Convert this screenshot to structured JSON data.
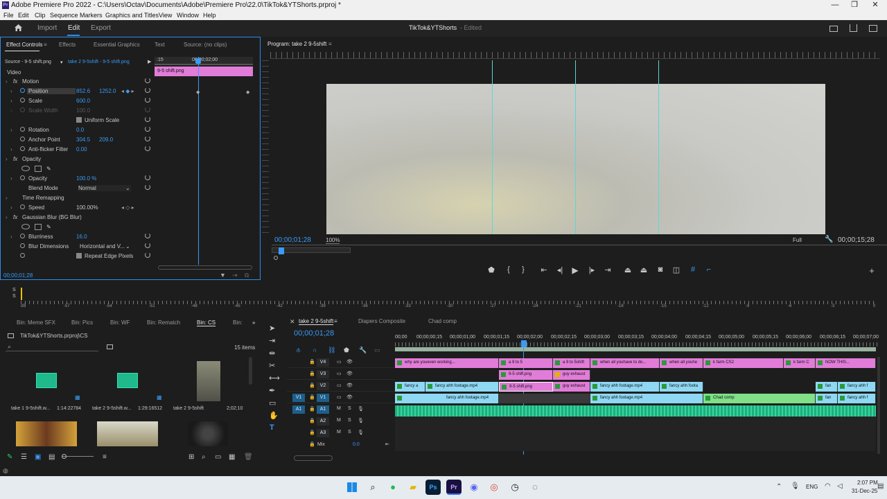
{
  "window": {
    "title": "Adobe Premiere Pro 2022 - C:\\Users\\Octav\\Documents\\Adobe\\Premiere Pro\\22.0\\TikTok&YTShorts.prproj *",
    "app_badge": "Pr"
  },
  "menu": [
    "File",
    "Edit",
    "Clip",
    "Sequence",
    "Markers",
    "Graphics and Titles",
    "View",
    "Window",
    "Help"
  ],
  "workspace": {
    "tabs": [
      "Import",
      "Edit",
      "Export"
    ],
    "active": "Edit",
    "project_name": "TikTok&YTShorts",
    "status": "- Edited"
  },
  "effect_controls": {
    "tabs": [
      "Effect Controls",
      "Effects",
      "Essential Graphics",
      "Text",
      "Source: (no clips)"
    ],
    "source": "Source - 9-5 shift.png",
    "sequence": "take 2 9-5shift - 9-5 shift.png",
    "mini_ruler_start": ":15",
    "mini_ruler_time": "00;00;02;00",
    "clip_label": "9-5 shift.png",
    "section_video": "Video",
    "motion": "Motion",
    "position_label": "Position",
    "position_x": "852.6",
    "position_y": "1252.0",
    "scale_label": "Scale",
    "scale_value": "600.0",
    "scale_width_label": "Scale Width",
    "scale_width_value": "100.0",
    "uniform_scale": "Uniform Scale",
    "rotation_label": "Rotation",
    "rotation_value": "0.0",
    "anchor_label": "Anchor Point",
    "anchor_x": "304.5",
    "anchor_y": "209.0",
    "antiflicker_label": "Anti-flicker Filter",
    "antiflicker_value": "0.00",
    "opacity_section": "Opacity",
    "opacity_label": "Opacity",
    "opacity_value": "100.0 %",
    "blend_label": "Blend Mode",
    "blend_value": "Normal",
    "time_remap": "Time Remapping",
    "speed_label": "Speed",
    "speed_value": "100.00%",
    "gblur": "Gaussian Blur (BG Blur)",
    "blurriness_label": "Blurriness",
    "blurriness_value": "16.0",
    "blur_dim_label": "Blur Dimensions",
    "blur_dim_value": "Horizontal and V...",
    "repeat_edge": "Repeat Edge Pixels",
    "timecode": "00;00;01;28"
  },
  "program": {
    "title": "Program: take 2 9-5shift",
    "timecode": "00;00;01;28",
    "zoom": "100%",
    "quality": "Full",
    "duration": "00;00;15;28"
  },
  "audio_meter": {
    "scale": [
      "dB",
      "-57",
      "-54",
      "-51",
      "-48",
      "-45",
      "-42",
      "-39",
      "-36",
      "-33",
      "-30",
      "-27",
      "-24",
      "-21",
      "-18",
      "-15",
      "-12",
      "-9",
      "-6",
      "-3",
      "0"
    ]
  },
  "project": {
    "bins": [
      "Bin: Meme SFX",
      "Bin: Pics",
      "Bin: WF",
      "Bin: Rematch",
      "Bin: CS",
      "Bin:"
    ],
    "path": "TikTok&YTShorts.prproj\\CS",
    "items_count": "15 items",
    "items": [
      {
        "name": "take 1 9-5shift.w...",
        "duration": "1:14:22784"
      },
      {
        "name": "take 2 9-5shift.w...",
        "duration": "1:29:16512"
      },
      {
        "name": "take 2 9-5shift",
        "duration": "2;02;10"
      }
    ]
  },
  "timeline": {
    "tabs": [
      "take 2 9-5shift",
      "Diapers Composite",
      "Chad comp"
    ],
    "timecode": "00;00;01;28",
    "ruler": [
      "00;00",
      "00;00;00;15",
      "00;00;01;00",
      "00;00;01;15",
      "00;00;02;00",
      "00;00;02;15",
      "00;00;03;00",
      "00;00;03;15",
      "00;00;04;00",
      "00;00;04;15",
      "00;00;05;00",
      "00;00;05;15",
      "00;00;06;00",
      "00;00;06;15",
      "00;00;07;00"
    ],
    "video_tracks": [
      "V4",
      "V3",
      "V2",
      "V1"
    ],
    "audio_tracks": [
      "A1",
      "A2",
      "A3"
    ],
    "mix_label": "Mix",
    "mix_value": "0.0",
    "v4_clips": [
      "why are youeven working...",
      "a 9 to 5",
      "a 9 to 5shift",
      "when all youhave to do...",
      "when all youhe",
      "k farm CS2",
      "k farm C",
      "NOW THIS..."
    ],
    "v3_clips": [
      "9-5 shift.png",
      "guy exhaust"
    ],
    "v2_clips": [
      "fancy a",
      "fancy ahh footage.mp4",
      "9-5 shift.png",
      "guy exhaust",
      "fancy ahh footage.mp4",
      "fancy ahh foota",
      "fan",
      "fancy ahh f"
    ],
    "v1_clips": [
      "fancy ahh footage.mp4",
      "fancy ahh footage.mp4",
      "Chad comp",
      "fan",
      "fancy ahh f"
    ]
  },
  "taskbar": {
    "language": "ENG",
    "time": "2:07 PM",
    "date": "31-Dec-25"
  }
}
